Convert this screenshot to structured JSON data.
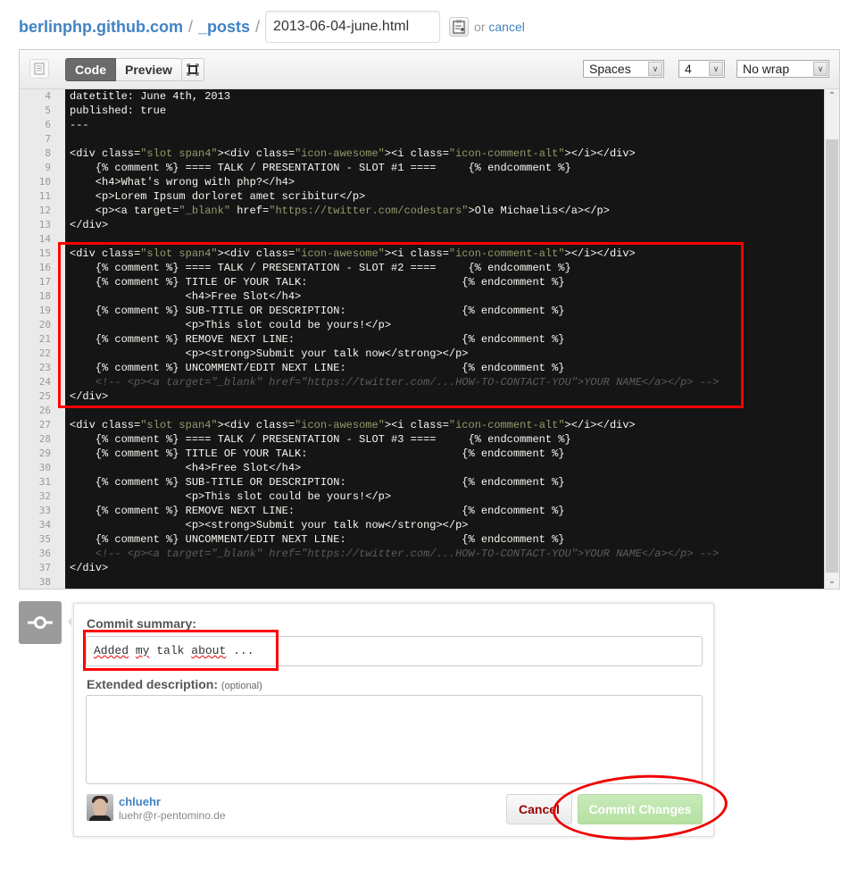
{
  "breadcrumb": {
    "repo": "berlinphp.github.com",
    "separator": "/",
    "directory": "_posts",
    "filename": "2013-06-04-june.html",
    "or_text": "or",
    "cancel_link": "cancel"
  },
  "toolbar": {
    "tabs": [
      {
        "label": "Code",
        "active": true
      },
      {
        "label": "Preview",
        "active": false
      }
    ],
    "indent_mode": "Spaces",
    "indent_size": "4",
    "wrap_mode": "No wrap"
  },
  "code": {
    "lines": [
      {
        "n": "4",
        "parts": [
          [
            "t",
            "datetitle: June 4th, 2013"
          ]
        ]
      },
      {
        "n": "5",
        "parts": [
          [
            "t",
            "published: true"
          ]
        ]
      },
      {
        "n": "6",
        "parts": [
          [
            "t",
            "---"
          ]
        ]
      },
      {
        "n": "7",
        "parts": []
      },
      {
        "n": "8",
        "parts": [
          [
            "t",
            "<div class="
          ],
          [
            "s",
            "\"slot span4\""
          ],
          [
            "t",
            "><div class="
          ],
          [
            "s",
            "\"icon-awesome\""
          ],
          [
            "t",
            "><i class="
          ],
          [
            "s",
            "\"icon-comment-alt\""
          ],
          [
            "t",
            "></i></div>"
          ]
        ]
      },
      {
        "n": "9",
        "parts": [
          [
            "t",
            "    {% comment %} ==== TALK / PRESENTATION - SLOT #1 ====     {% endcomment %}"
          ]
        ]
      },
      {
        "n": "10",
        "parts": [
          [
            "t",
            "    <h4>What's wrong with php?</h4>"
          ]
        ]
      },
      {
        "n": "11",
        "parts": [
          [
            "t",
            "    <p>Lorem Ipsum dorloret amet scribitur</p>"
          ]
        ]
      },
      {
        "n": "12",
        "parts": [
          [
            "t",
            "    <p><a target="
          ],
          [
            "s",
            "\"_blank\""
          ],
          [
            "t",
            " href="
          ],
          [
            "s",
            "\"https://twitter.com/codestars\""
          ],
          [
            "t",
            ">Ole Michaelis</a></p>"
          ]
        ]
      },
      {
        "n": "13",
        "parts": [
          [
            "t",
            "</div>"
          ]
        ]
      },
      {
        "n": "14",
        "parts": []
      },
      {
        "n": "15",
        "parts": [
          [
            "t",
            "<div class="
          ],
          [
            "s",
            "\"slot span4\""
          ],
          [
            "t",
            "><div class="
          ],
          [
            "s",
            "\"icon-awesome\""
          ],
          [
            "t",
            "><i class="
          ],
          [
            "s",
            "\"icon-comment-alt\""
          ],
          [
            "t",
            "></i></div>"
          ]
        ]
      },
      {
        "n": "16",
        "parts": [
          [
            "t",
            "    {% comment %} ==== TALK / PRESENTATION - SLOT #2 ====     {% endcomment %}"
          ]
        ]
      },
      {
        "n": "17",
        "parts": [
          [
            "t",
            "    {% comment %} TITLE OF YOUR TALK:                        {% endcomment %}"
          ]
        ]
      },
      {
        "n": "18",
        "parts": [
          [
            "t",
            "                  <h4>Free Slot</h4>"
          ]
        ]
      },
      {
        "n": "19",
        "parts": [
          [
            "t",
            "    {% comment %} SUB-TITLE OR DESCRIPTION:                  {% endcomment %}"
          ]
        ]
      },
      {
        "n": "20",
        "parts": [
          [
            "t",
            "                  <p>This slot could be yours!</p>"
          ]
        ]
      },
      {
        "n": "21",
        "parts": [
          [
            "t",
            "    {% comment %} REMOVE NEXT LINE:                          {% endcomment %}"
          ]
        ]
      },
      {
        "n": "22",
        "parts": [
          [
            "t",
            "                  <p><strong>Submit your talk now</strong></p>"
          ]
        ]
      },
      {
        "n": "23",
        "parts": [
          [
            "t",
            "    {% comment %} UNCOMMENT/EDIT NEXT LINE:                  {% endcomment %}"
          ]
        ]
      },
      {
        "n": "24",
        "parts": [
          [
            "c",
            "    <!-- <p><a target=\"_blank\" href=\"https://twitter.com/...HOW-TO-CONTACT-YOU\">YOUR NAME</a></p> -->"
          ]
        ]
      },
      {
        "n": "25",
        "parts": [
          [
            "t",
            "</div>"
          ]
        ]
      },
      {
        "n": "26",
        "parts": []
      },
      {
        "n": "27",
        "parts": [
          [
            "t",
            "<div class="
          ],
          [
            "s",
            "\"slot span4\""
          ],
          [
            "t",
            "><div class="
          ],
          [
            "s",
            "\"icon-awesome\""
          ],
          [
            "t",
            "><i class="
          ],
          [
            "s",
            "\"icon-comment-alt\""
          ],
          [
            "t",
            "></i></div>"
          ]
        ]
      },
      {
        "n": "28",
        "parts": [
          [
            "t",
            "    {% comment %} ==== TALK / PRESENTATION - SLOT #3 ====     {% endcomment %}"
          ]
        ]
      },
      {
        "n": "29",
        "parts": [
          [
            "t",
            "    {% comment %} TITLE OF YOUR TALK:                        {% endcomment %}"
          ]
        ]
      },
      {
        "n": "30",
        "parts": [
          [
            "t",
            "                  <h4>Free Slot</h4>"
          ]
        ]
      },
      {
        "n": "31",
        "parts": [
          [
            "t",
            "    {% comment %} SUB-TITLE OR DESCRIPTION:                  {% endcomment %}"
          ]
        ]
      },
      {
        "n": "32",
        "parts": [
          [
            "t",
            "                  <p>This slot could be yours!</p>"
          ]
        ]
      },
      {
        "n": "33",
        "parts": [
          [
            "t",
            "    {% comment %} REMOVE NEXT LINE:                          {% endcomment %}"
          ]
        ]
      },
      {
        "n": "34",
        "parts": [
          [
            "t",
            "                  <p><strong>Submit your talk now</strong></p>"
          ]
        ]
      },
      {
        "n": "35",
        "parts": [
          [
            "t",
            "    {% comment %} UNCOMMENT/EDIT NEXT LINE:                  {% endcomment %}"
          ]
        ]
      },
      {
        "n": "36",
        "parts": [
          [
            "c",
            "    <!-- <p><a target=\"_blank\" href=\"https://twitter.com/...HOW-TO-CONTACT-YOU\">YOUR NAME</a></p> -->"
          ]
        ]
      },
      {
        "n": "37",
        "parts": [
          [
            "t",
            "</div>"
          ]
        ]
      },
      {
        "n": "38",
        "parts": []
      }
    ]
  },
  "commit": {
    "summary_label": "Commit summary:",
    "summary_value": "Added my talk about ...",
    "summary_misspelled": [
      "Added",
      "my",
      "about"
    ],
    "description_label": "Extended description:",
    "description_optional": "(optional)",
    "description_value": "",
    "user_name": "chluehr",
    "user_email": "luehr@r-pentomino.de",
    "cancel_label": "Cancel",
    "commit_label": "Commit Changes"
  },
  "colors": {
    "link": "#4183c4",
    "code_bg": "#151515",
    "code_string": "#8f9d6a",
    "code_comment": "#5f5a60",
    "annotation_red": "#ff0000",
    "commit_button": "#b5e0a2"
  }
}
